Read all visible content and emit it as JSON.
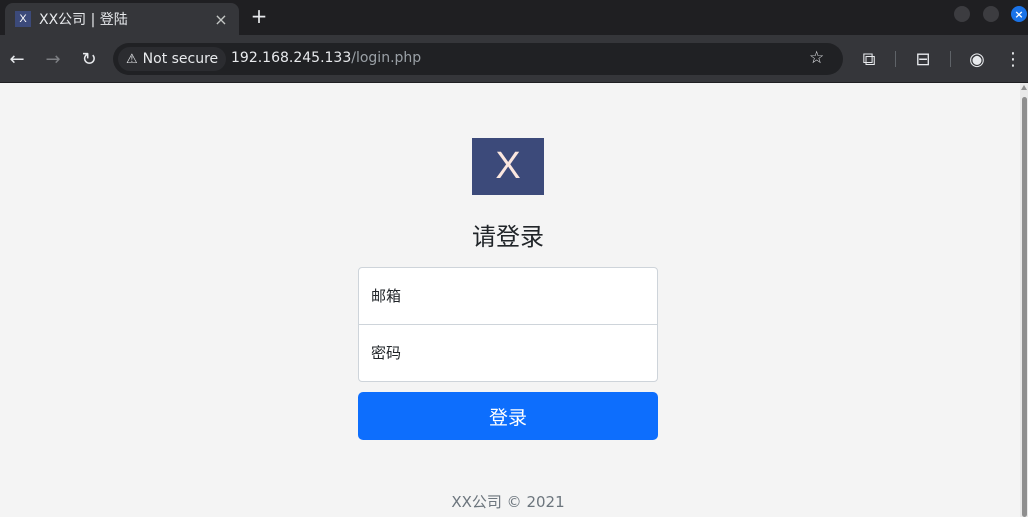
{
  "browser": {
    "tab": {
      "favicon": "X",
      "title": "XX公司 | 登陆",
      "close_icon": "×"
    },
    "new_tab_icon": "+",
    "window": {
      "close_icon": "×"
    },
    "toolbar": {
      "back_icon": "←",
      "forward_icon": "→",
      "reload_icon": "↻",
      "security_icon": "⚠",
      "security_label": "Not secure",
      "url_host": "192.168.245.133",
      "url_path": "/login.php",
      "bookmark_icon": "☆",
      "extensions_icon": "⧉",
      "tab_search_icon": "⊟",
      "profile_icon": "◉",
      "menu_icon": "⋮"
    }
  },
  "page": {
    "logo_text": "X",
    "heading": "请登录",
    "email_placeholder": "邮箱",
    "password_placeholder": "密码",
    "submit_label": "登录",
    "footer": "XX公司 © 2021"
  },
  "colors": {
    "logo_bg": "#3c4a7a",
    "primary_button": "#0d6efd",
    "page_bg": "#f4f4f4"
  }
}
